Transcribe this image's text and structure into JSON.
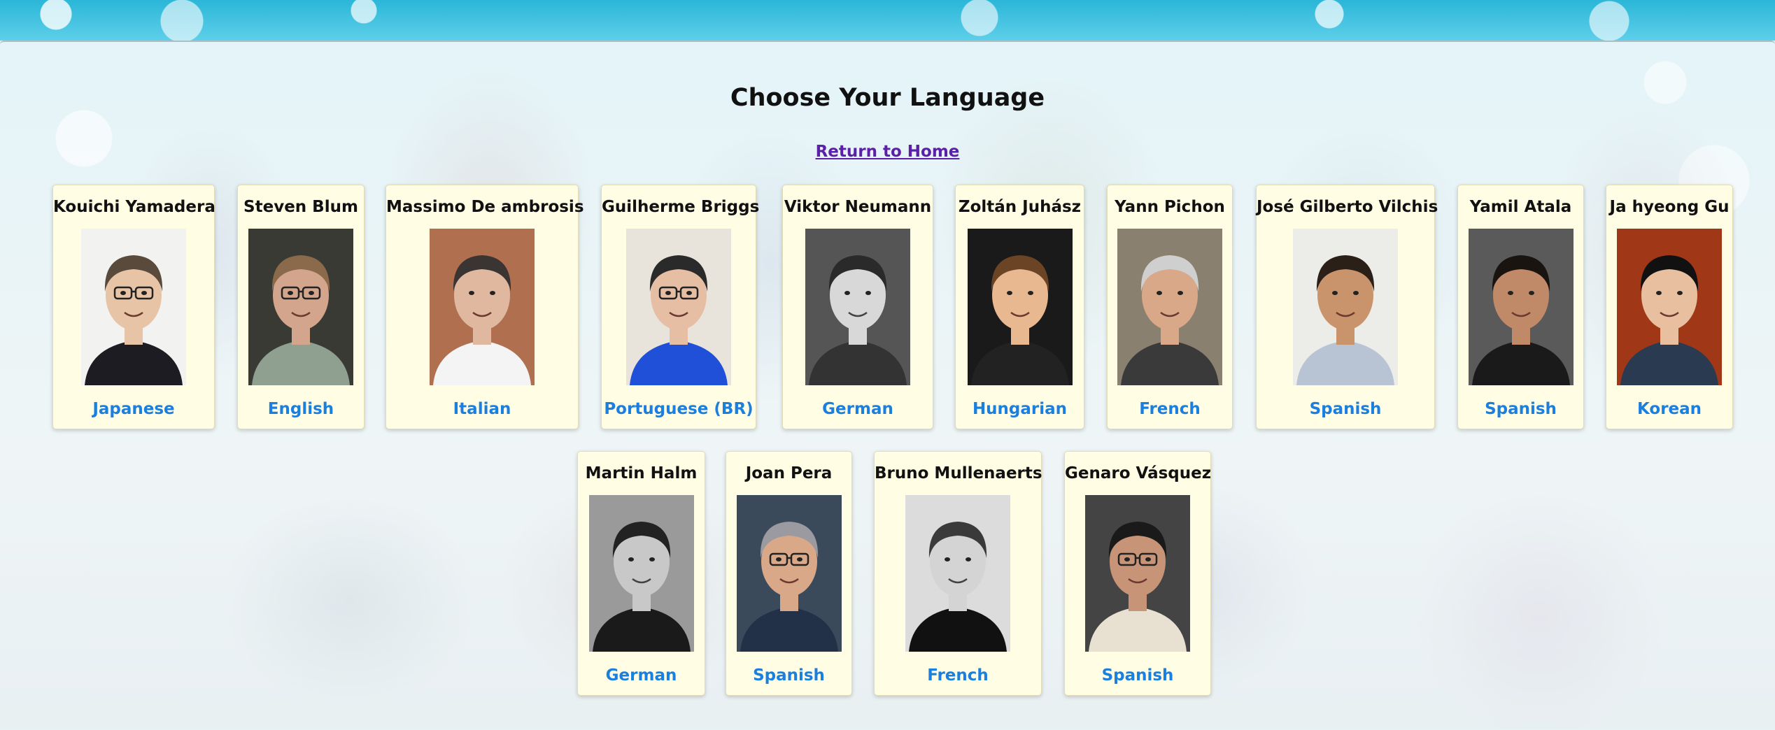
{
  "page": {
    "title": "Choose Your Language",
    "home_link": "Return to Home"
  },
  "actors": [
    {
      "name": "Kouichi Yamadera",
      "language": "Japanese",
      "bg": "#f2f2f0",
      "skin": "#e8c4a6",
      "hair": "#5a4a3c",
      "shirt": "#1c1c22",
      "mono": false,
      "glasses": true
    },
    {
      "name": "Steven Blum",
      "language": "English",
      "bg": "#3a3a34",
      "skin": "#d3a58c",
      "hair": "#8a6a4a",
      "shirt": "#8fa090",
      "mono": false,
      "glasses": true
    },
    {
      "name": "Massimo De ambrosis",
      "language": "Italian",
      "bg": "#b07050",
      "skin": "#e0b8a0",
      "hair": "#3a3432",
      "shirt": "#f4f4f4",
      "mono": false,
      "glasses": false
    },
    {
      "name": "Guilherme Briggs",
      "language": "Portuguese (BR)",
      "bg": "#e8e4dc",
      "skin": "#e6bea4",
      "hair": "#2a2a2a",
      "shirt": "#2050d8",
      "mono": false,
      "glasses": true
    },
    {
      "name": "Viktor Neumann",
      "language": "German",
      "bg": "#555555",
      "skin": "#d8d8d8",
      "hair": "#2a2a2a",
      "shirt": "#333333",
      "mono": true,
      "glasses": false
    },
    {
      "name": "Zoltán Juhász",
      "language": "Hungarian",
      "bg": "#1a1a1a",
      "skin": "#e8b890",
      "hair": "#6a4424",
      "shirt": "#222222",
      "mono": false,
      "glasses": false
    },
    {
      "name": "Yann Pichon",
      "language": "French",
      "bg": "#8a8070",
      "skin": "#d9a888",
      "hair": "#cfcfcf",
      "shirt": "#3a3a3a",
      "mono": false,
      "glasses": false
    },
    {
      "name": "José Gilberto Vilchis",
      "language": "Spanish",
      "bg": "#ecece8",
      "skin": "#c9946c",
      "hair": "#2a2018",
      "shirt": "#b8c4d4",
      "mono": false,
      "glasses": false
    },
    {
      "name": "Yamil Atala",
      "language": "Spanish",
      "bg": "#5a5a5a",
      "skin": "#c08a68",
      "hair": "#1a1410",
      "shirt": "#1a1a1a",
      "mono": false,
      "glasses": false
    },
    {
      "name": "Ja hyeong Gu",
      "language": "Korean",
      "bg": "#a03818",
      "skin": "#e8c0a0",
      "hair": "#111111",
      "shirt": "#2a3a50",
      "mono": false,
      "glasses": false
    },
    {
      "name": "Martin Halm",
      "language": "German",
      "bg": "#9a9a9a",
      "skin": "#c8c8c8",
      "hair": "#222222",
      "shirt": "#1a1a1a",
      "mono": true,
      "glasses": false
    },
    {
      "name": "Joan Pera",
      "language": "Spanish",
      "bg": "#3a4a5a",
      "skin": "#d8a888",
      "hair": "#9a9aa0",
      "shirt": "#223048",
      "mono": false,
      "glasses": true
    },
    {
      "name": "Bruno Mullenaerts",
      "language": "French",
      "bg": "#dcdcdc",
      "skin": "#d4d4d4",
      "hair": "#3a3a3a",
      "shirt": "#111111",
      "mono": true,
      "glasses": false
    },
    {
      "name": "Genaro Vásquez",
      "language": "Spanish",
      "bg": "#444444",
      "skin": "#c89478",
      "hair": "#1a1a1a",
      "shirt": "#e8e0d0",
      "mono": false,
      "glasses": true
    }
  ]
}
